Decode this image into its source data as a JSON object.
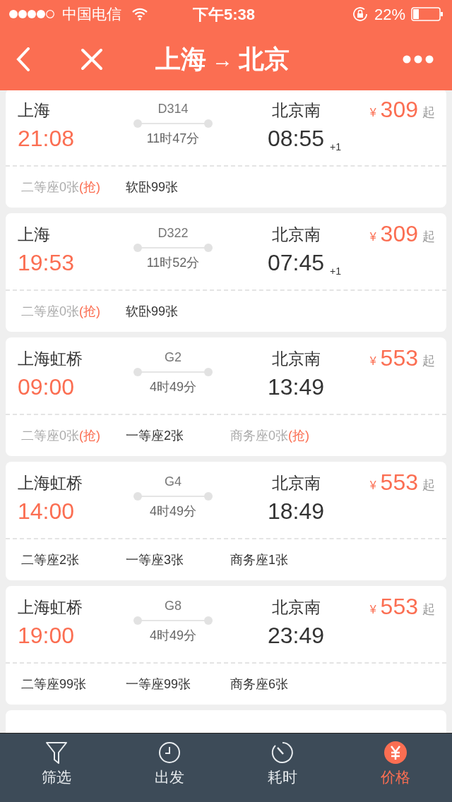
{
  "status_bar": {
    "carrier": "中国电信",
    "time": "下午5:38",
    "battery": "22%"
  },
  "header": {
    "from": "上海",
    "arrow": "→",
    "to": "北京"
  },
  "trains": [
    {
      "from": "上海",
      "depart": "21:08",
      "code": "D314",
      "duration": "11时47分",
      "to": "北京南",
      "arrive": "08:55",
      "next_day": "+1",
      "currency": "¥",
      "price": "309",
      "price_suffix": "起",
      "seats": [
        {
          "label": "二等座0张",
          "available": false,
          "grab": "(抢)"
        },
        {
          "label": "软卧99张",
          "available": true
        }
      ]
    },
    {
      "from": "上海",
      "depart": "19:53",
      "code": "D322",
      "duration": "11时52分",
      "to": "北京南",
      "arrive": "07:45",
      "next_day": "+1",
      "currency": "¥",
      "price": "309",
      "price_suffix": "起",
      "seats": [
        {
          "label": "二等座0张",
          "available": false,
          "grab": "(抢)"
        },
        {
          "label": "软卧99张",
          "available": true
        }
      ]
    },
    {
      "from": "上海虹桥",
      "depart": "09:00",
      "code": "G2",
      "duration": "4时49分",
      "to": "北京南",
      "arrive": "13:49",
      "currency": "¥",
      "price": "553",
      "price_suffix": "起",
      "seats": [
        {
          "label": "二等座0张",
          "available": false,
          "grab": "(抢)"
        },
        {
          "label": "一等座2张",
          "available": true
        },
        {
          "label": "商务座0张",
          "available": false,
          "grab": "(抢)"
        }
      ]
    },
    {
      "from": "上海虹桥",
      "depart": "14:00",
      "code": "G4",
      "duration": "4时49分",
      "to": "北京南",
      "arrive": "18:49",
      "currency": "¥",
      "price": "553",
      "price_suffix": "起",
      "seats": [
        {
          "label": "二等座2张",
          "available": true
        },
        {
          "label": "一等座3张",
          "available": true
        },
        {
          "label": "商务座1张",
          "available": true
        }
      ]
    },
    {
      "from": "上海虹桥",
      "depart": "19:00",
      "code": "G8",
      "duration": "4时49分",
      "to": "北京南",
      "arrive": "23:49",
      "currency": "¥",
      "price": "553",
      "price_suffix": "起",
      "seats": [
        {
          "label": "二等座99张",
          "available": true
        },
        {
          "label": "一等座99张",
          "available": true
        },
        {
          "label": "商务座6张",
          "available": true
        }
      ]
    }
  ],
  "tab_bar": [
    {
      "kind": "filter",
      "label": "筛选",
      "selected": false
    },
    {
      "kind": "clock",
      "label": "出发",
      "selected": false
    },
    {
      "kind": "timer",
      "label": "耗时",
      "selected": false
    },
    {
      "kind": "price",
      "label": "价格",
      "selected": true
    }
  ]
}
